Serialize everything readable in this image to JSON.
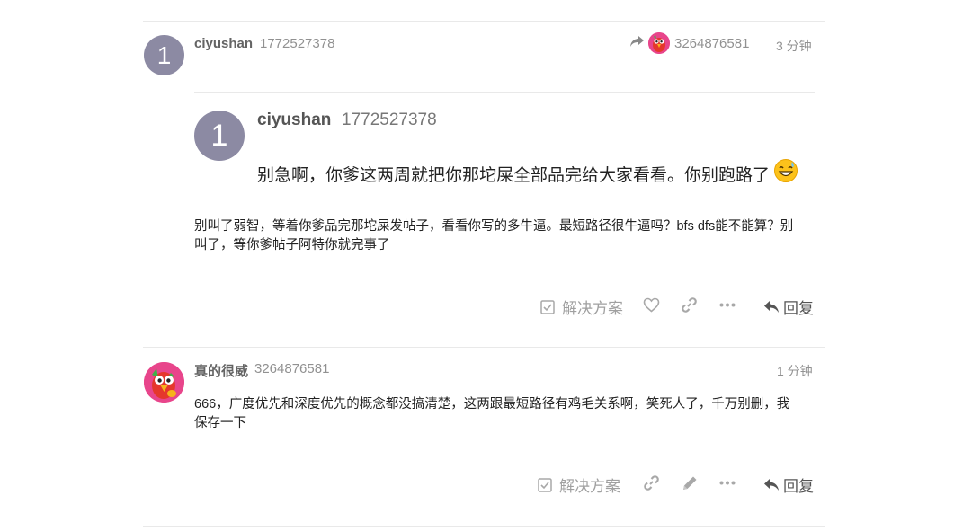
{
  "post1": {
    "username": "ciyushan",
    "user_id": "1772527378",
    "avatar_letter": "1",
    "reply_to_id": "3264876581",
    "time": "3 分钟",
    "quote": {
      "avatar_letter": "1",
      "username": "ciyushan",
      "user_id": "1772527378",
      "text": "别急啊，你爹这两周就把你那坨屎全部品完给大家看看。你别跑路了"
    },
    "body_line1": "别叫了弱智，等着你爹品完那坨屎发帖子，看看你写的多牛逼。最短路径很牛逼吗？bfs dfs能不能算？别",
    "body_line2": "叫了，等你爹帖子阿特你就完事了",
    "actions": {
      "solution": "解决方案",
      "reply": "回复"
    }
  },
  "post2": {
    "username": "真的很威",
    "user_id": "3264876581",
    "time": "1 分钟",
    "body_line1": "666，广度优先和深度优先的概念都没搞清楚，这两跟最短路径有鸡毛关系啊，笑死人了，千万别删，我",
    "body_line2": "保存一下",
    "actions": {
      "solution": "解决方案",
      "reply": "回复"
    }
  },
  "icons": {
    "share": "share-arrow-icon",
    "checkbox": "checkbox-icon",
    "heart": "heart-icon",
    "link": "link-icon",
    "more": "ellipsis-icon",
    "reply": "reply-arrow-icon",
    "edit": "pencil-icon",
    "emoji": "grinning-sweat-emoji"
  },
  "colors": {
    "avatar_purple": "#8c8aa3",
    "avatar_pink": "#e8458b",
    "muted_text": "#919191",
    "action_gray": "#a0a0a0"
  }
}
